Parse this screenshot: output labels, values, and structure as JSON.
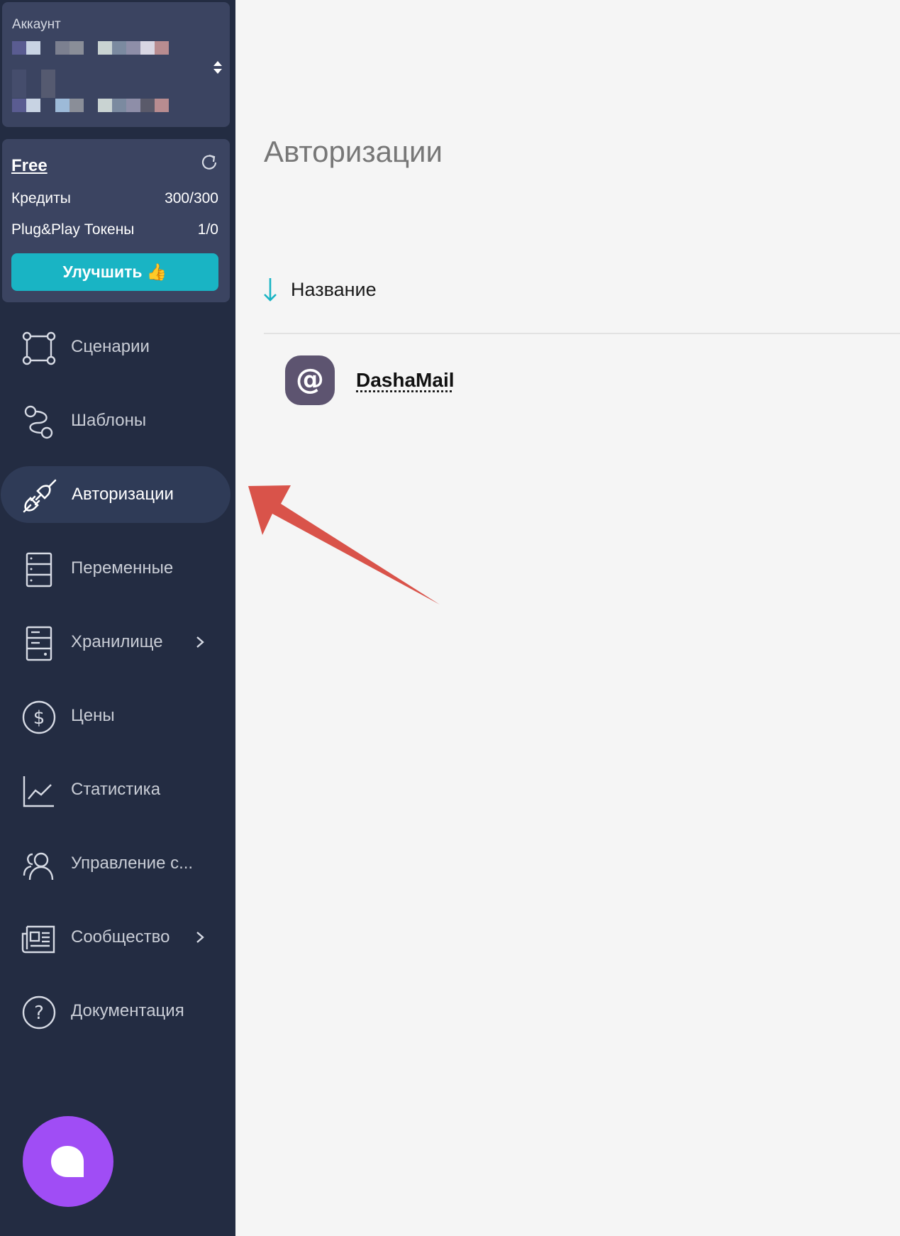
{
  "account": {
    "label": "Аккаунт",
    "switch_icon": "sort-updown-icon"
  },
  "plan": {
    "name": "Free",
    "refresh_icon": "refresh-icon",
    "credits_label": "Кредиты",
    "credits_value": "300/300",
    "tokens_label": "Plug&Play Токены",
    "tokens_value": "1/0",
    "upgrade_label": "Улучшить 👍"
  },
  "nav": [
    {
      "label": "Сценарии",
      "icon": "scenarios-icon"
    },
    {
      "label": "Шаблоны",
      "icon": "templates-icon"
    },
    {
      "label": "Авторизации",
      "icon": "plug-icon",
      "active": true
    },
    {
      "label": "Переменные",
      "icon": "variables-icon"
    },
    {
      "label": "Хранилище",
      "icon": "storage-icon",
      "chevron": true
    },
    {
      "label": "Цены",
      "icon": "dollar-icon"
    },
    {
      "label": "Статистика",
      "icon": "chart-icon"
    },
    {
      "label": "Управление с...",
      "icon": "users-icon"
    },
    {
      "label": "Сообщество",
      "icon": "news-icon",
      "chevron": true
    },
    {
      "label": "Документация",
      "icon": "help-icon"
    }
  ],
  "main": {
    "title": "Авторизации",
    "sort_label": "Название",
    "items": [
      {
        "name": "DashaMail",
        "icon": "at-sign-icon"
      }
    ]
  },
  "colors": {
    "sidebar": "#232c42",
    "card": "#3b4461",
    "accent": "#19b4c4",
    "chat": "#a04df5",
    "annotation": "#d9534a"
  }
}
